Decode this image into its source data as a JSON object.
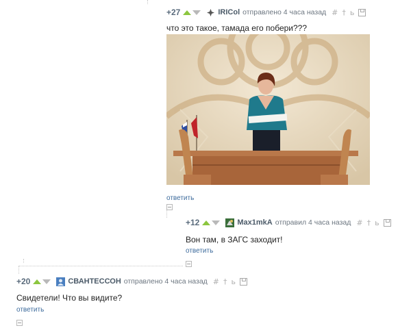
{
  "comments": [
    {
      "rating": "+27",
      "author": "IRICol",
      "meta": "отправлено 4 часа назад",
      "text": "что это такое, тамада его побери???",
      "reply_label": "ответить",
      "image": {
        "icon": "photo"
      }
    },
    {
      "rating": "+12",
      "author": "Max1mkA",
      "meta": "отправил 4 часа назад",
      "text": "Вон там, в ЗАГС заходит!",
      "reply_label": "ответить"
    },
    {
      "rating": "+20",
      "author": "СВАНТЕССОН",
      "meta": "отправлено 4 часа назад",
      "text": "Свидетели! Что вы видите?",
      "reply_label": "ответить"
    }
  ],
  "tools": {
    "hash": "#",
    "pin": "†",
    "quote": "ь"
  },
  "colors": {
    "up": "#8cc63f",
    "down": "#b9b9b9",
    "link": "#3d6b9c",
    "author": "#4b5a68"
  }
}
